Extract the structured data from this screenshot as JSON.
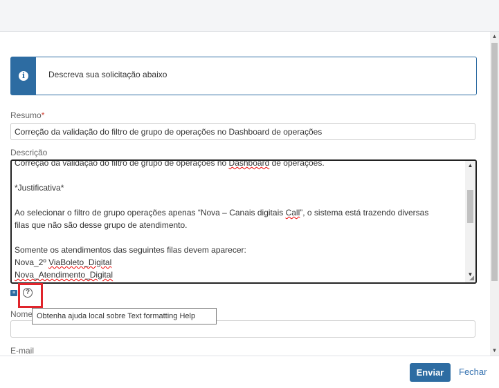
{
  "info": {
    "message": "Descreva sua solicitação abaixo"
  },
  "fields": {
    "resumo": {
      "label": "Resumo",
      "required_mark": "*",
      "value": "Correção da validação do filtro de grupo de operações no Dashboard de operações"
    },
    "descricao": {
      "label": "Descrição",
      "lines": [
        "Correção da validação do filtro de grupo de operações no Dashboard de operações.",
        "",
        "*Justificativa*",
        "",
        "Ao selecionar o filtro de grupo operações apenas “Nova – Canais digitais Call”, o sistema está trazendo diversas",
        "filas que não são desse grupo de atendimento.",
        "",
        "Somente os atendimentos das seguintes filas devem aparecer:",
        "Nova_2º ViaBoleto_Digital",
        "Nova_Atendimento_Digital"
      ]
    },
    "nome": {
      "label": "Nome",
      "value": ""
    },
    "email": {
      "label": "E-mail"
    }
  },
  "icons": {
    "info": "info-icon",
    "text_format": "text-format-icon",
    "help": "help-icon"
  },
  "tooltip": {
    "text": "Obtenha ajuda local sobre Text formatting Help"
  },
  "footer": {
    "submit_label": "Enviar",
    "close_label": "Fechar"
  },
  "colors": {
    "primary": "#2d6ca2",
    "highlight": "#e0242b",
    "required": "#d04437"
  }
}
